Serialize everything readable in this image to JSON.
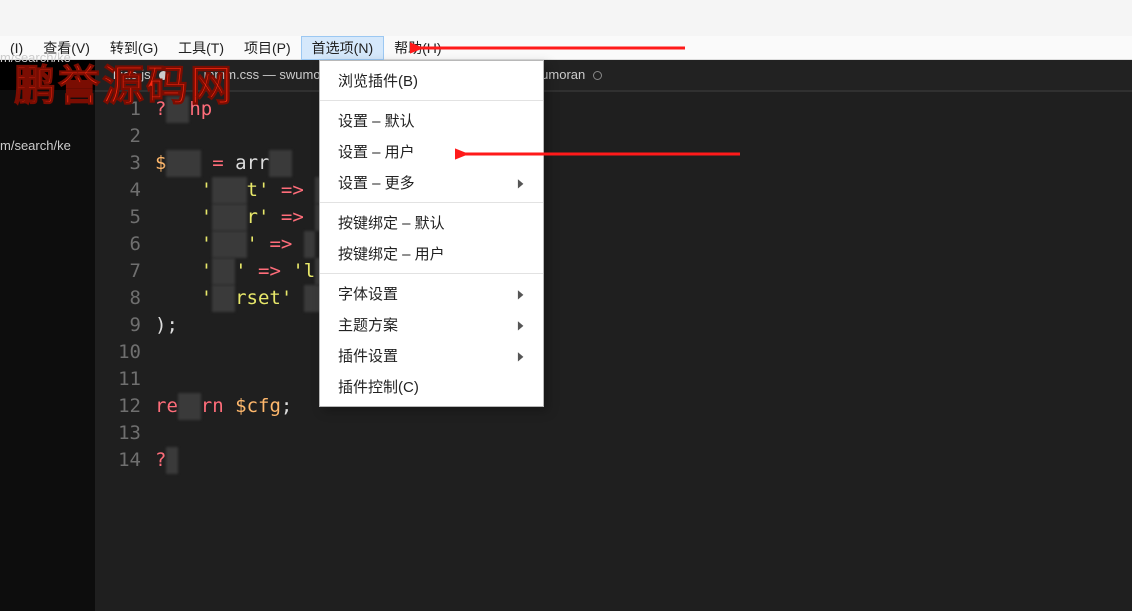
{
  "menubar": {
    "items": [
      {
        "label": "(I)"
      },
      {
        "label": "查看(V)"
      },
      {
        "label": "转到(G)"
      },
      {
        "label": "工具(T)"
      },
      {
        "label": "项目(P)"
      },
      {
        "label": "首选项(N)"
      },
      {
        "label": "帮助(H)"
      }
    ],
    "active_index": 5
  },
  "path_fragment": "m/search/ke",
  "watermark": "鹏誉源码网",
  "tabs": [
    {
      "label": "biao.js",
      "dirty": true
    },
    {
      "label": "mmm.css — swumoran\\wumoran",
      "dirty": true
    },
    {
      "label": "mmm.css — swumoran",
      "dirty": false
    }
  ],
  "dropdown": {
    "groups": [
      [
        {
          "label": "浏览插件(B)",
          "submenu": false
        }
      ],
      [
        {
          "label": "设置 – 默认",
          "submenu": false
        },
        {
          "label": "设置 – 用户",
          "submenu": false
        },
        {
          "label": "设置 – 更多",
          "submenu": true
        }
      ],
      [
        {
          "label": "按键绑定 – 默认",
          "submenu": false
        },
        {
          "label": "按键绑定 – 用户",
          "submenu": false
        }
      ],
      [
        {
          "label": "字体设置",
          "submenu": true
        },
        {
          "label": "主题方案",
          "submenu": true
        },
        {
          "label": "插件设置",
          "submenu": true
        },
        {
          "label": "插件控制(C)",
          "submenu": false
        }
      ]
    ]
  },
  "code": {
    "lines": [
      {
        "n": 1,
        "segs": [
          {
            "c": "tok-tag",
            "t": "?"
          },
          {
            "c": "censor",
            "t": "▮▮"
          },
          {
            "c": "tok-tag",
            "t": "hp"
          }
        ]
      },
      {
        "n": 2,
        "segs": []
      },
      {
        "n": 3,
        "segs": [
          {
            "c": "tok-var",
            "t": "$"
          },
          {
            "c": "censor",
            "t": "▮▮▮"
          },
          {
            "c": "tok-plain",
            "t": " "
          },
          {
            "c": "tok-op",
            "t": "="
          },
          {
            "c": "tok-plain",
            "t": " arr"
          },
          {
            "c": "censor",
            "t": "▮▮"
          }
        ]
      },
      {
        "n": 4,
        "segs": [
          {
            "c": "tok-plain",
            "t": "    "
          },
          {
            "c": "tok-str",
            "t": "'"
          },
          {
            "c": "censor",
            "t": "▮▮▮"
          },
          {
            "c": "tok-str",
            "t": "t'"
          },
          {
            "c": "tok-plain",
            "t": " "
          },
          {
            "c": "tok-op",
            "t": "=>"
          },
          {
            "c": "tok-plain",
            "t": " "
          },
          {
            "c": "censor",
            "t": "▮"
          }
        ]
      },
      {
        "n": 5,
        "segs": [
          {
            "c": "tok-plain",
            "t": "    "
          },
          {
            "c": "tok-str",
            "t": "'"
          },
          {
            "c": "censor",
            "t": "▮▮▮"
          },
          {
            "c": "tok-str",
            "t": "r'"
          },
          {
            "c": "tok-plain",
            "t": " "
          },
          {
            "c": "tok-op",
            "t": "=>"
          },
          {
            "c": "tok-plain",
            "t": " "
          },
          {
            "c": "censor",
            "t": "▮"
          }
        ]
      },
      {
        "n": 6,
        "segs": [
          {
            "c": "tok-plain",
            "t": "    "
          },
          {
            "c": "tok-str",
            "t": "'"
          },
          {
            "c": "censor",
            "t": "▮▮▮"
          },
          {
            "c": "tok-str",
            "t": "'"
          },
          {
            "c": "tok-plain",
            "t": " "
          },
          {
            "c": "tok-op",
            "t": "=>"
          },
          {
            "c": "tok-plain",
            "t": " "
          },
          {
            "c": "censor",
            "t": "▮"
          }
        ]
      },
      {
        "n": 7,
        "segs": [
          {
            "c": "tok-plain",
            "t": "    "
          },
          {
            "c": "tok-str",
            "t": "'"
          },
          {
            "c": "censor",
            "t": "▮▮"
          },
          {
            "c": "tok-str",
            "t": "'"
          },
          {
            "c": "tok-plain",
            "t": " "
          },
          {
            "c": "tok-op",
            "t": "=>"
          },
          {
            "c": "tok-plain",
            "t": " "
          },
          {
            "c": "tok-str",
            "t": "'l"
          },
          {
            "c": "censor",
            "t": "▮▮"
          }
        ]
      },
      {
        "n": 8,
        "segs": [
          {
            "c": "tok-plain",
            "t": "    "
          },
          {
            "c": "tok-str",
            "t": "'"
          },
          {
            "c": "censor",
            "t": "▮▮"
          },
          {
            "c": "tok-str",
            "t": "rset'"
          },
          {
            "c": "tok-plain",
            "t": " "
          },
          {
            "c": "censor",
            "t": "▮▮"
          }
        ]
      },
      {
        "n": 9,
        "segs": [
          {
            "c": "tok-punc",
            "t": ");"
          }
        ]
      },
      {
        "n": 10,
        "segs": []
      },
      {
        "n": 11,
        "segs": []
      },
      {
        "n": 12,
        "segs": [
          {
            "c": "tok-kw",
            "t": "re"
          },
          {
            "c": "censor",
            "t": "▮▮"
          },
          {
            "c": "tok-kw",
            "t": "rn"
          },
          {
            "c": "tok-plain",
            "t": " "
          },
          {
            "c": "tok-var",
            "t": "$cfg"
          },
          {
            "c": "tok-punc",
            "t": ";"
          }
        ]
      },
      {
        "n": 13,
        "segs": []
      },
      {
        "n": 14,
        "segs": [
          {
            "c": "tok-tag",
            "t": "?"
          },
          {
            "c": "censor",
            "t": "▮"
          }
        ]
      }
    ]
  },
  "arrows": {
    "color": "#ff1a1a"
  }
}
